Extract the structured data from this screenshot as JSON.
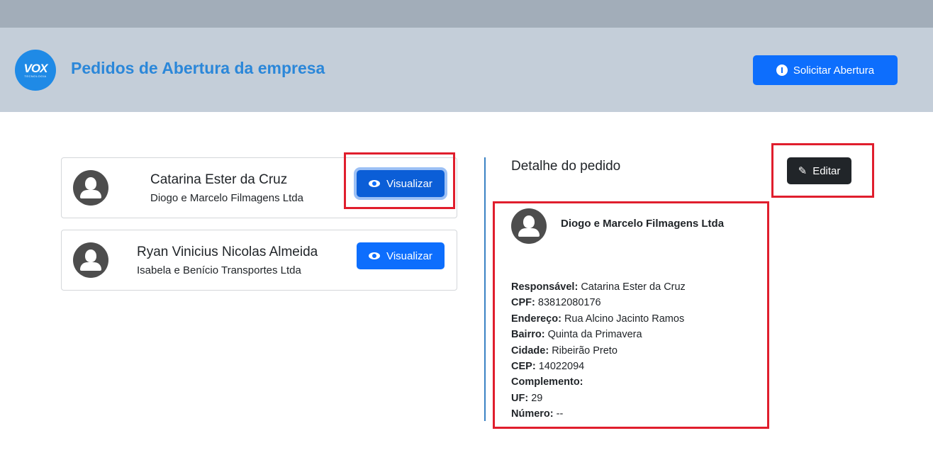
{
  "header": {
    "logo_text": "VOX",
    "logo_subtext": "TECNOLOGIA",
    "title": "Pedidos de Abertura da empresa",
    "solicitar_label": "Solicitar Abertura"
  },
  "orders": [
    {
      "name": "Catarina Ester da Cruz",
      "company": "Diogo e Marcelo Filmagens Ltda",
      "view_label": "Visualizar"
    },
    {
      "name": "Ryan Vinicius Nicolas Almeida",
      "company": "Isabela e Benício Transportes Ltda",
      "view_label": "Visualizar"
    }
  ],
  "detail": {
    "title": "Detalhe do pedido",
    "edit_label": "Editar",
    "company": "Diogo e Marcelo Filmagens Ltda",
    "fields": [
      {
        "label": "Responsável:",
        "value": "Catarina Ester da Cruz"
      },
      {
        "label": "CPF:",
        "value": "83812080176"
      },
      {
        "label": "Endereço:",
        "value": "Rua Alcino Jacinto Ramos"
      },
      {
        "label": "Bairro:",
        "value": "Quinta da Primavera"
      },
      {
        "label": "Cidade:",
        "value": "Ribeirão Preto"
      },
      {
        "label": "CEP:",
        "value": "14022094"
      },
      {
        "label": "Complemento:",
        "value": ""
      },
      {
        "label": "UF:",
        "value": "29"
      },
      {
        "label": "Número:",
        "value": "--"
      }
    ]
  },
  "icons": {
    "solicitar": "plus-circle-icon",
    "view": "eye-icon",
    "edit": "pencil-icon",
    "avatar": "user-avatar-icon"
  },
  "colors": {
    "primary": "#0d6efd",
    "title": "#2b87d9",
    "header_bg": "#c4ced9",
    "top_strip": "#a2adb9",
    "highlight": "#e01e2d",
    "dark_button": "#212529"
  }
}
